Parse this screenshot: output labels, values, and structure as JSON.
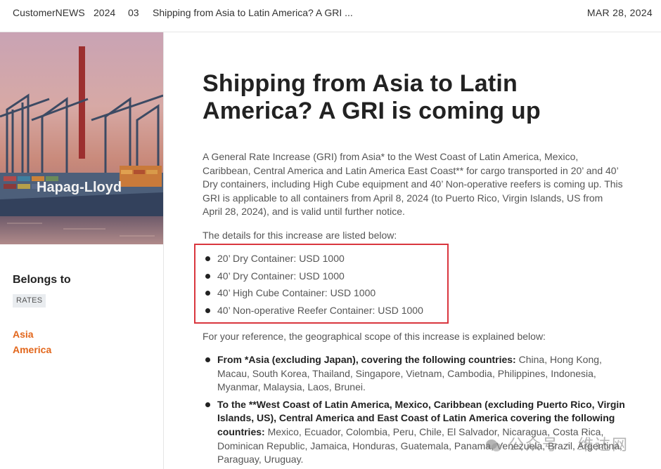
{
  "topbar": {
    "brand": "CustomerNEWS",
    "year": "2024",
    "month": "03",
    "article_crumb": "Shipping from Asia to Latin America? A GRI ...",
    "date": "MAR 28, 2024"
  },
  "hero": {
    "logo_text": "Hapag-Lloyd"
  },
  "sidebar": {
    "belongs_label": "Belongs to",
    "tag": "RATES",
    "regions": [
      "Asia",
      "America"
    ]
  },
  "article": {
    "title": "Shipping from Asia to Latin America? A GRI is coming up",
    "intro": "A General Rate Increase (GRI) from Asia* to the West Coast of Latin America, Mexico, Caribbean, Central America and Latin America East Coast** for cargo transported in 20’ and 40’ Dry containers, including High Cube equipment and 40’ Non-operative reefers is coming up. This GRI is applicable to all containers from April 8, 2024 (to Puerto Rico, Virgin Islands, US from April 28, 2024), and is valid until further notice.",
    "details_intro": "The details for this increase are listed below:",
    "rates": [
      "20’ Dry Container: USD 1000",
      "40’ Dry Container: USD 1000",
      "40’ High Cube Container: USD 1000",
      "40’ Non-operative Reefer Container: USD 1000"
    ],
    "scope_intro": "For your reference, the geographical scope of this increase is explained below:",
    "scope": [
      {
        "bold": "From *Asia (excluding Japan), covering the following countries:",
        "text": " China, Hong Kong, Macau, South Korea, Thailand, Singapore, Vietnam, Cambodia, Philippines, Indonesia, Myanmar, Malaysia, Laos, Brunei."
      },
      {
        "bold": "To the **West Coast of Latin America, Mexico, Caribbean (excluding Puerto Rico, Virgin Islands, US), Central America and East Coast of Latin America covering the following countries:",
        "text": " Mexico, Ecuador, Colombia, Peru, Chile, El Salvador, Nicaragua, Costa Rica, Dominican Republic, Jamaica, Honduras, Guatemala, Panama, Venezuela, Brazil, Argentina, Paraguay, Uruguay."
      }
    ]
  },
  "watermark": "公众号 · 维达网",
  "colors": {
    "accent": "#e2661b",
    "highlight_border": "#d9363e",
    "tag_bg": "#e9ecef"
  }
}
